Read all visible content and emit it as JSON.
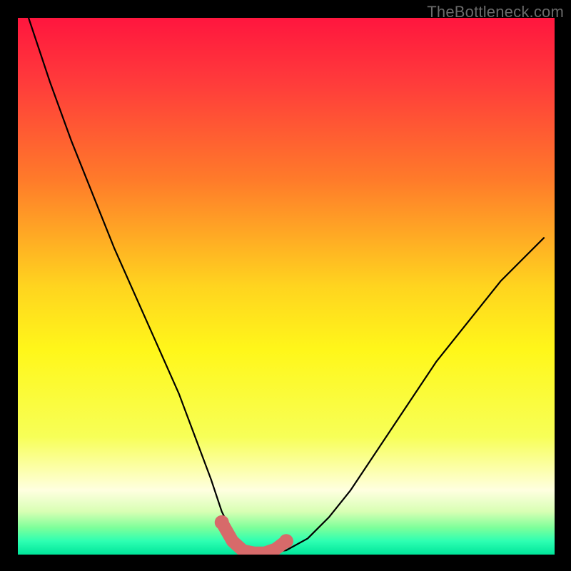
{
  "watermark": "TheBottleneck.com",
  "chart_data": {
    "type": "line",
    "title": "",
    "xlabel": "",
    "ylabel": "",
    "xlim": [
      0,
      100
    ],
    "ylim": [
      0,
      100
    ],
    "series": [
      {
        "name": "curve",
        "x": [
          2,
          6,
          10,
          14,
          18,
          22,
          26,
          30,
          33,
          36,
          38,
          40,
          42,
          44,
          46,
          50,
          54,
          58,
          62,
          66,
          70,
          74,
          78,
          82,
          86,
          90,
          94,
          98
        ],
        "y": [
          100,
          88,
          77,
          67,
          57,
          48,
          39,
          30,
          22,
          14,
          8,
          4,
          1,
          0.3,
          0.3,
          0.8,
          3,
          7,
          12,
          18,
          24,
          30,
          36,
          41,
          46,
          51,
          55,
          59
        ]
      },
      {
        "name": "highlight",
        "x": [
          38,
          40,
          42,
          44,
          46,
          48,
          50
        ],
        "y": [
          6,
          2.5,
          0.7,
          0.3,
          0.3,
          1.0,
          2.5
        ]
      }
    ],
    "annotations": [],
    "gradient_stops": [
      {
        "pos": 0.0,
        "color": "#ff163e"
      },
      {
        "pos": 0.12,
        "color": "#ff3b3b"
      },
      {
        "pos": 0.3,
        "color": "#ff7a2a"
      },
      {
        "pos": 0.5,
        "color": "#ffd41f"
      },
      {
        "pos": 0.62,
        "color": "#fff71a"
      },
      {
        "pos": 0.78,
        "color": "#f7ff57"
      },
      {
        "pos": 0.88,
        "color": "#ffffe0"
      },
      {
        "pos": 0.92,
        "color": "#d8ffb4"
      },
      {
        "pos": 0.95,
        "color": "#7dff9a"
      },
      {
        "pos": 0.975,
        "color": "#2dffb2"
      },
      {
        "pos": 1.0,
        "color": "#00e59a"
      }
    ]
  },
  "layout": {
    "outer": 800,
    "inner_left": 25,
    "inner_top": 25,
    "inner_width": 752,
    "inner_height": 752
  }
}
